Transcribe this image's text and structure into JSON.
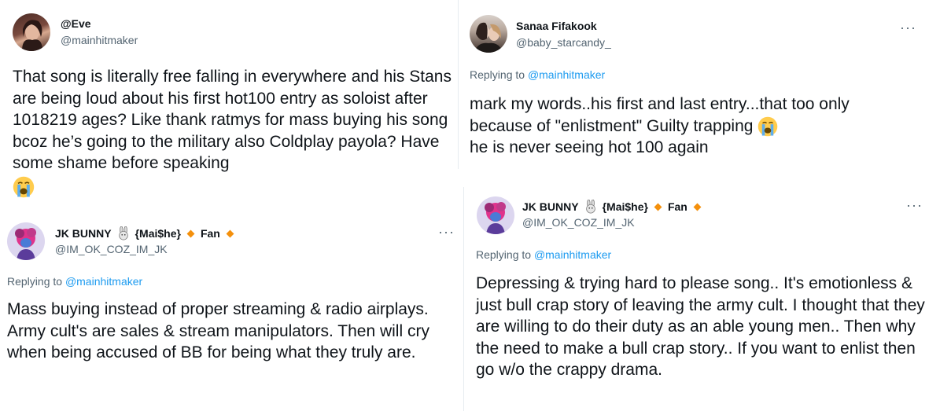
{
  "tweet1": {
    "display_name": "@Eve",
    "handle": "@mainhitmaker",
    "text": "That song is literally free falling in everywhere and his Stans are being loud about his first hot100 entry as soloist after 1018219 ages? Like thank ratmys for mass buying his song bcoz he’s going to the military also Coldplay payola? Have some shame before speaking",
    "emoji": "loudly-crying-face"
  },
  "tweet2": {
    "display_name": "Sanaa Fifakook",
    "handle": "@baby_starcandy_",
    "replying_prefix": "Replying to",
    "replying_to": "@mainhitmaker",
    "line1": "mark my words..his first and last entry...that too only",
    "line2": "because of \"enlistment\" Guilty trapping",
    "line3": "he is never seeing hot 100 again",
    "emoji": "loudly-crying-face",
    "more": "···"
  },
  "tweet3": {
    "display_name": "JK BUNNY",
    "display_name_mid": "{Mai$he}",
    "display_name_end": "Fan",
    "handle": "@IM_OK_COZ_IM_JK",
    "replying_prefix": "Replying to",
    "replying_to": "@mainhitmaker",
    "text": "Mass buying instead of proper streaming & radio airplays. Army cult's are sales & stream manipulators. Then will cry when being accused of BB for being what they truly are.",
    "more": "···"
  },
  "tweet4": {
    "display_name": "JK BUNNY",
    "display_name_mid": "{Mai$he}",
    "display_name_end": "Fan",
    "handle": "@IM_OK_COZ_IM_JK",
    "replying_prefix": "Replying to",
    "replying_to": "@mainhitmaker",
    "text": "Depressing & trying hard to please song.. It's emotionless & just bull crap story of leaving the army cult. I thought that they are willing to do their duty as an able young men.. Then why the need to make a bull crap story.. If you want to enlist then go w/o the crappy drama.",
    "more": "···"
  },
  "colors": {
    "text": "#0f1419",
    "secondary": "#536471",
    "mention": "#1d9bf0",
    "diamond": "#f4900c"
  }
}
